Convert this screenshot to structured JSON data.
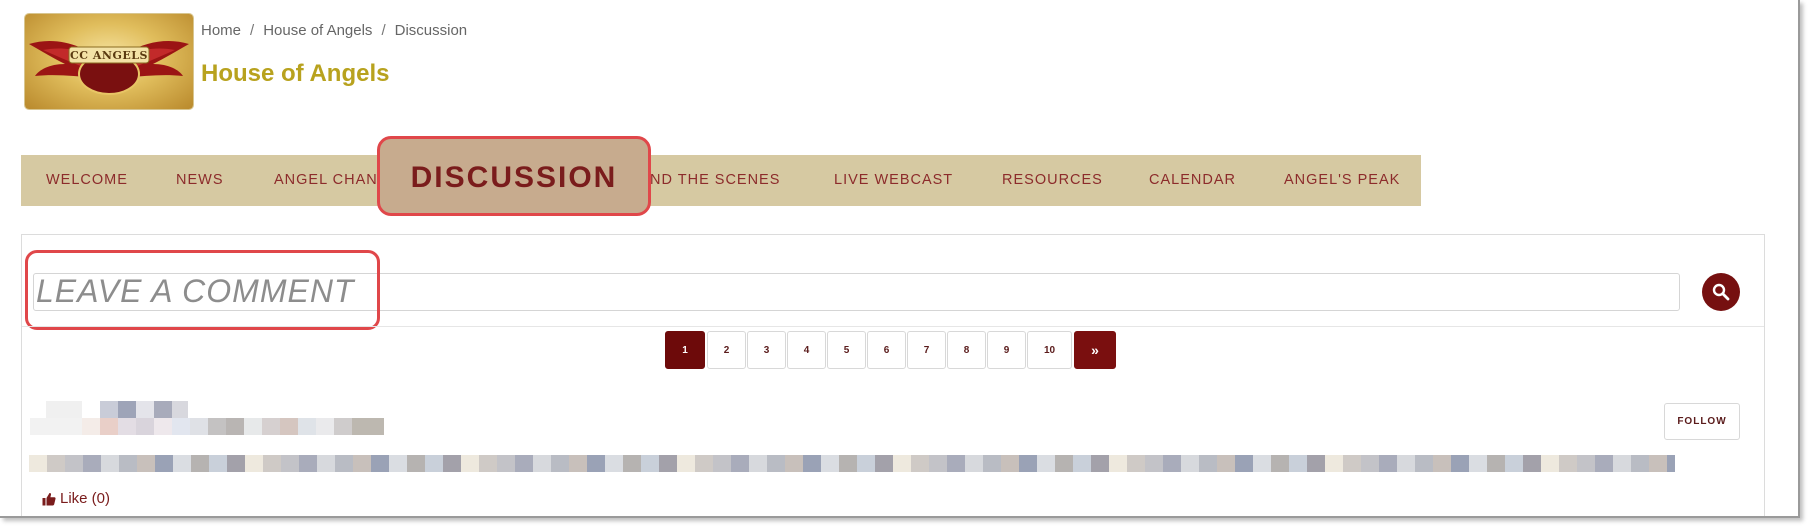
{
  "header": {
    "logo_text": "CC ANGELS",
    "breadcrumb": [
      "Home",
      "House of Angels",
      "Discussion"
    ],
    "title": "House of Angels"
  },
  "nav": {
    "items": [
      {
        "label": "WELCOME"
      },
      {
        "label": "NEWS"
      },
      {
        "label": "ANGEL CHAN"
      },
      {
        "label": "DISCUSSION"
      },
      {
        "label": "IND THE SCENES"
      },
      {
        "label": "LIVE WEBCAST"
      },
      {
        "label": "RESOURCES"
      },
      {
        "label": "CALENDAR"
      },
      {
        "label": "ANGEL'S PEAK"
      }
    ],
    "active": "DISCUSSION"
  },
  "comment": {
    "placeholder": "LEAVE A COMMENT"
  },
  "pagination": {
    "pages": [
      "1",
      "2",
      "3",
      "4",
      "5",
      "6",
      "7",
      "8",
      "9",
      "10"
    ],
    "current": "1",
    "next_label": "»"
  },
  "post": {
    "follow_label": "FOLLOW",
    "like_label": "Like (0)"
  },
  "colors": {
    "accent": "#761010",
    "nav_bg": "#d6c9a2",
    "title": "#b8a21e",
    "highlight_border": "#e0474a"
  }
}
